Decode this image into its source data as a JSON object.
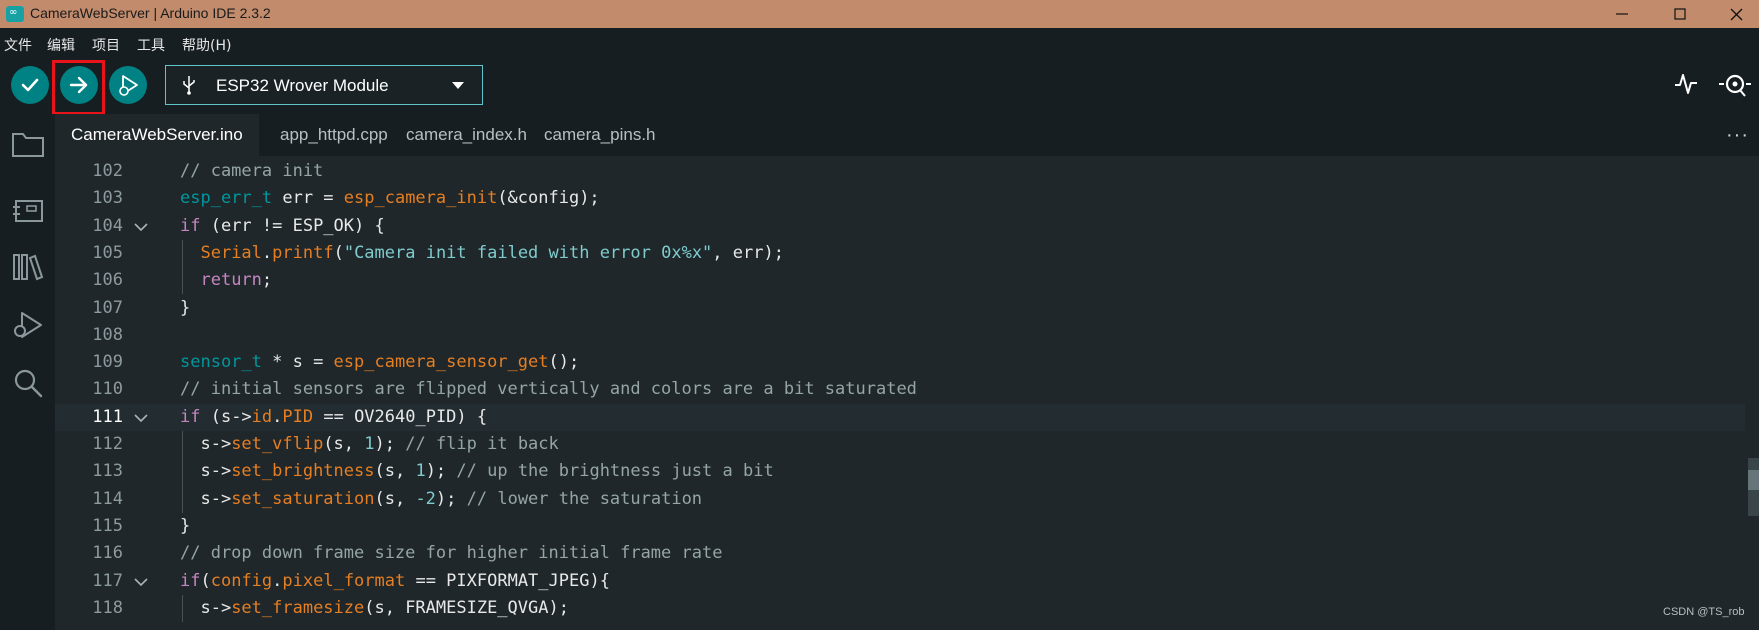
{
  "window": {
    "title": "CameraWebServer | Arduino IDE 2.3.2",
    "app_icon_glyph": "∞"
  },
  "menu": [
    "文件",
    "编辑",
    "项目",
    "工具",
    "帮助(H)"
  ],
  "toolbar": {
    "board": "ESP32 Wrover Module",
    "icons": [
      "verify-icon",
      "upload-icon",
      "debug-icon",
      "serial-plotter-icon",
      "serial-monitor-icon"
    ]
  },
  "sidebar_icons": [
    "sketchbook-icon",
    "boards-manager-icon",
    "library-manager-icon",
    "debug-icon",
    "search-icon"
  ],
  "tabs": [
    {
      "label": "CameraWebServer.ino",
      "active": true
    },
    {
      "label": "app_httpd.cpp",
      "active": false
    },
    {
      "label": "camera_index.h",
      "active": false
    },
    {
      "label": "camera_pins.h",
      "active": false
    }
  ],
  "tab_more": "···",
  "editor": {
    "current_line": 111,
    "lines": [
      {
        "n": "102",
        "tokens": [
          {
            "t": "// camera init",
            "c": "t-cm"
          }
        ]
      },
      {
        "n": "103",
        "tokens": [
          {
            "t": "esp_err_t",
            "c": "t-ty"
          },
          {
            "t": " err = ",
            "c": "t-pl"
          },
          {
            "t": "esp_camera_init",
            "c": "t-fn"
          },
          {
            "t": "(&config);",
            "c": "t-pl"
          }
        ]
      },
      {
        "n": "104",
        "fold": true,
        "tokens": [
          {
            "t": "if",
            "c": "t-kw"
          },
          {
            "t": " (err != ESP_OK) {",
            "c": "t-pl"
          }
        ]
      },
      {
        "n": "105",
        "tokens": [
          {
            "t": "  ",
            "c": "t-pl"
          },
          {
            "t": "Serial",
            "c": "t-fn"
          },
          {
            "t": ".",
            "c": "t-pl"
          },
          {
            "t": "printf",
            "c": "t-fn"
          },
          {
            "t": "(",
            "c": "t-pl"
          },
          {
            "t": "\"Camera init failed with error 0x%x\"",
            "c": "t-st"
          },
          {
            "t": ", err);",
            "c": "t-pl"
          }
        ]
      },
      {
        "n": "106",
        "tokens": [
          {
            "t": "  ",
            "c": "t-pl"
          },
          {
            "t": "return",
            "c": "t-kw"
          },
          {
            "t": ";",
            "c": "t-pl"
          }
        ]
      },
      {
        "n": "107",
        "tokens": [
          {
            "t": "}",
            "c": "t-pl"
          }
        ]
      },
      {
        "n": "108",
        "tokens": []
      },
      {
        "n": "109",
        "tokens": [
          {
            "t": "sensor_t",
            "c": "t-ty"
          },
          {
            "t": " * s = ",
            "c": "t-pl"
          },
          {
            "t": "esp_camera_sensor_get",
            "c": "t-fn"
          },
          {
            "t": "();",
            "c": "t-pl"
          }
        ]
      },
      {
        "n": "110",
        "tokens": [
          {
            "t": "// initial sensors are flipped vertically and colors are a bit saturated",
            "c": "t-cm"
          }
        ]
      },
      {
        "n": "111",
        "fold": true,
        "tokens": [
          {
            "t": "if",
            "c": "t-kw"
          },
          {
            "t": " (s->",
            "c": "t-pl"
          },
          {
            "t": "id",
            "c": "t-fn"
          },
          {
            "t": ".",
            "c": "t-pl"
          },
          {
            "t": "PID",
            "c": "t-fn"
          },
          {
            "t": " == OV2640_PID) {",
            "c": "t-pl"
          }
        ]
      },
      {
        "n": "112",
        "tokens": [
          {
            "t": "  s->",
            "c": "t-pl"
          },
          {
            "t": "set_vflip",
            "c": "t-fn"
          },
          {
            "t": "(s, ",
            "c": "t-pl"
          },
          {
            "t": "1",
            "c": "t-nm"
          },
          {
            "t": "); ",
            "c": "t-pl"
          },
          {
            "t": "// flip it back",
            "c": "t-cm"
          }
        ]
      },
      {
        "n": "113",
        "tokens": [
          {
            "t": "  s->",
            "c": "t-pl"
          },
          {
            "t": "set_brightness",
            "c": "t-fn"
          },
          {
            "t": "(s, ",
            "c": "t-pl"
          },
          {
            "t": "1",
            "c": "t-nm"
          },
          {
            "t": "); ",
            "c": "t-pl"
          },
          {
            "t": "// up the brightness just a bit",
            "c": "t-cm"
          }
        ]
      },
      {
        "n": "114",
        "tokens": [
          {
            "t": "  s->",
            "c": "t-pl"
          },
          {
            "t": "set_saturation",
            "c": "t-fn"
          },
          {
            "t": "(s, ",
            "c": "t-pl"
          },
          {
            "t": "-2",
            "c": "t-nm"
          },
          {
            "t": "); ",
            "c": "t-pl"
          },
          {
            "t": "// lower the saturation",
            "c": "t-cm"
          }
        ]
      },
      {
        "n": "115",
        "tokens": [
          {
            "t": "}",
            "c": "t-pl"
          }
        ]
      },
      {
        "n": "116",
        "tokens": [
          {
            "t": "// drop down frame size for higher initial frame rate",
            "c": "t-cm"
          }
        ]
      },
      {
        "n": "117",
        "fold": true,
        "tokens": [
          {
            "t": "if",
            "c": "t-kw"
          },
          {
            "t": "(",
            "c": "t-pl"
          },
          {
            "t": "config",
            "c": "t-fn"
          },
          {
            "t": ".",
            "c": "t-pl"
          },
          {
            "t": "pixel_format",
            "c": "t-fn"
          },
          {
            "t": " == PIXFORMAT_JPEG){",
            "c": "t-pl"
          }
        ]
      },
      {
        "n": "118",
        "tokens": [
          {
            "t": "  s->",
            "c": "t-pl"
          },
          {
            "t": "set_framesize",
            "c": "t-fn"
          },
          {
            "t": "(s, FRAMESIZE_QVGA);",
            "c": "t-pl"
          }
        ]
      }
    ]
  },
  "watermark": "CSDN @TS_rob",
  "colors": {
    "titlebar": "#c18b6c",
    "accent": "#008184",
    "highlight_box": "#e8141a"
  }
}
